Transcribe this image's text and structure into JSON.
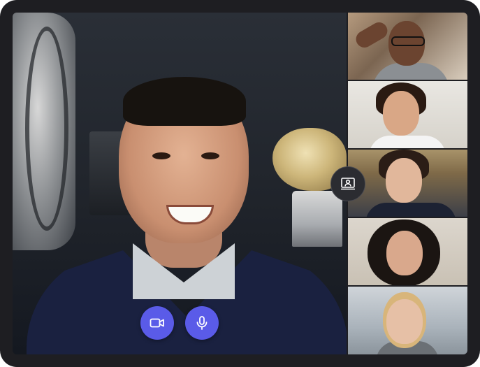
{
  "app": {
    "frame_color": "#1e1e22",
    "accent": "#5a5be8"
  },
  "main_stage": {
    "participant": "main-speaker"
  },
  "controls": {
    "video_icon": "video-camera-icon",
    "mic_icon": "microphone-icon",
    "share_icon": "share-screen-icon"
  },
  "participants": [
    {
      "id": "participant-1"
    },
    {
      "id": "participant-2"
    },
    {
      "id": "participant-3"
    },
    {
      "id": "participant-4"
    },
    {
      "id": "participant-5"
    }
  ]
}
